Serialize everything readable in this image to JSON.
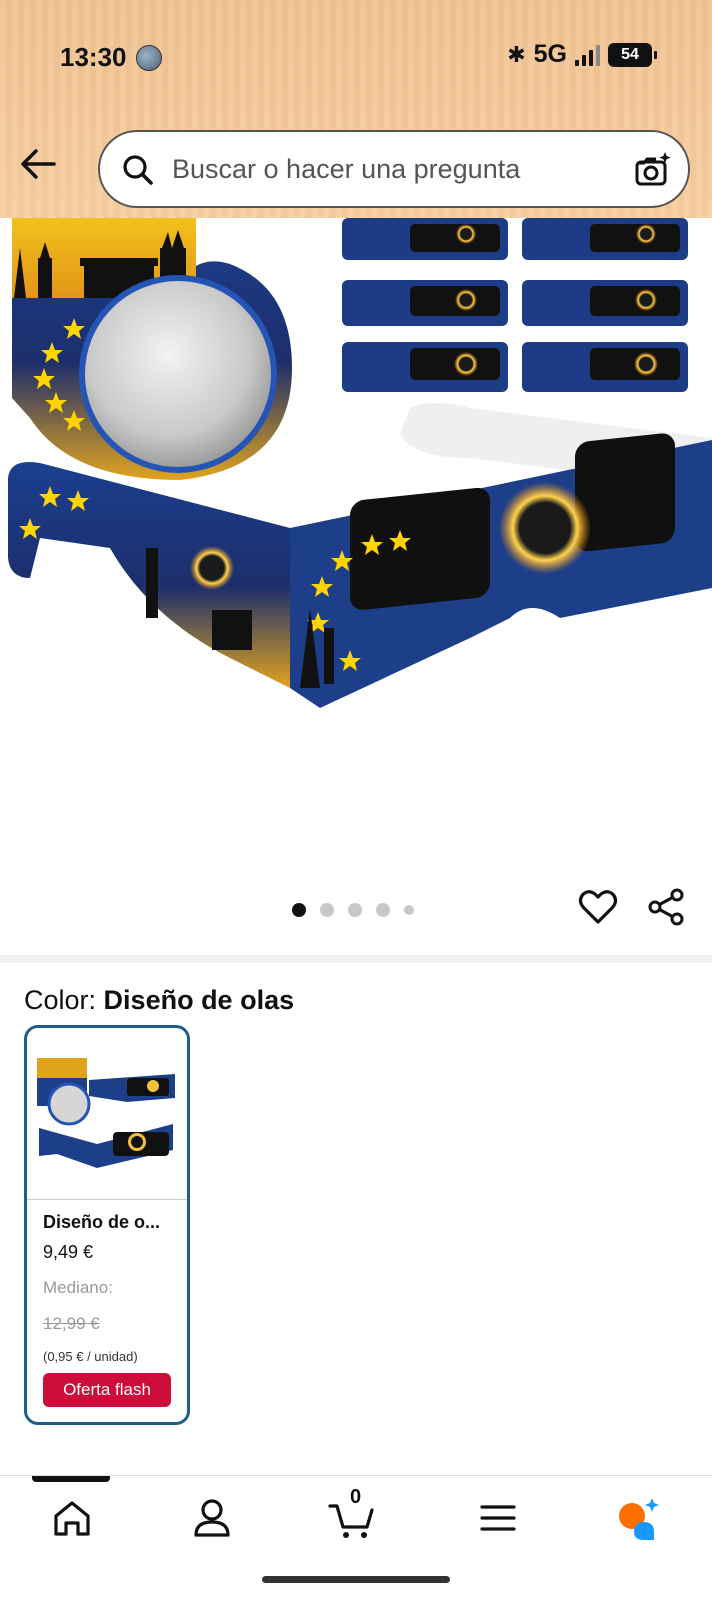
{
  "status_bar": {
    "time": "13:30",
    "network": "5G",
    "battery": "54"
  },
  "header": {
    "search_placeholder": "Buscar o hacer una pregunta",
    "back_icon": "arrow-left-icon",
    "search_icon": "search-icon",
    "camera_icon": "camera-lens-icon"
  },
  "gallery": {
    "dots": 5,
    "active_index": 0
  },
  "color_section": {
    "label": "Color:",
    "selected": "Diseño de olas"
  },
  "variant": {
    "name": "Diseño de o...",
    "price": "9,49 €",
    "size_label": "Mediano:",
    "old_price": "12,99 €",
    "unit_price": "(0,95 € / unidad)",
    "badge": "Oferta flash"
  },
  "bottom_nav": {
    "cart_count": "0",
    "items": [
      "home-icon",
      "account-icon",
      "cart-icon",
      "menu-icon",
      "rufus-ai-icon"
    ]
  },
  "colors": {
    "accent_border": "#1f5f8b",
    "badge_red": "#cc0c39",
    "header_bg": "#f5c99a",
    "rufus_orange": "#ff6f00",
    "rufus_blue": "#1a98ff"
  }
}
